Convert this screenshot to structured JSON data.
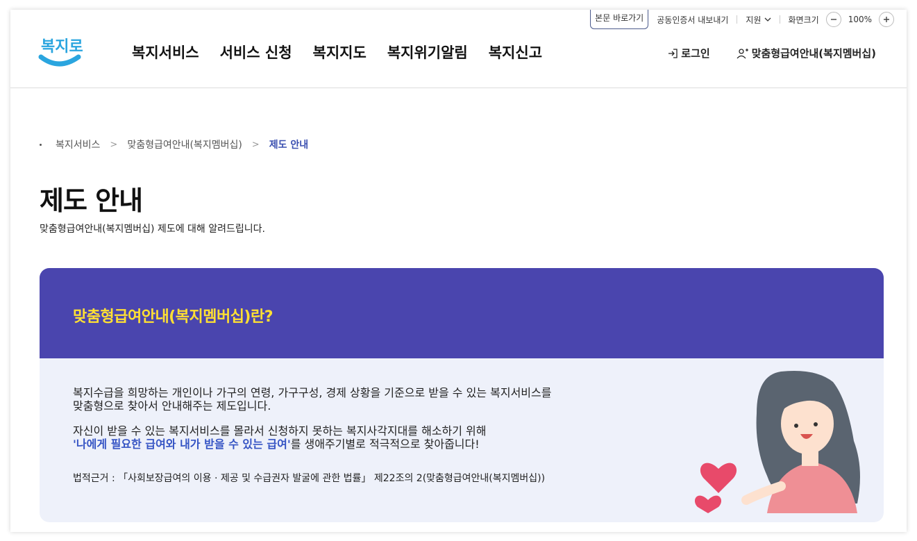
{
  "header": {
    "logo_text": "복지로",
    "skip_link": "본문 바로가기",
    "cert_export": "공동인증서 내보내기",
    "support": "지원",
    "screen_size": "화면크기",
    "zoom_level": "100%",
    "nav": [
      "복지서비스",
      "서비스 신청",
      "복지지도",
      "복지위기알림",
      "복지신고"
    ],
    "login": "로그인",
    "membership": "맞춤형급여안내(복지멤버십)"
  },
  "breadcrumb": [
    "복지서비스",
    "맞춤형급여안내(복지멤버십)",
    "제도 안내"
  ],
  "page": {
    "title": "제도 안내",
    "subtitle": "맞춤형급여안내(복지멤버십) 제도에 대해 알려드립니다."
  },
  "card": {
    "heading": "맞춤형급여안내(복지멤버십)란?",
    "para1_line1": "복지수급을 희망하는 개인이나 가구의 연령, 가구구성, 경제 상황을 기준으로 받을 수 있는 복지서비스를",
    "para1_line2": "맞춤형으로 찾아서 안내해주는 제도입니다.",
    "para2_line1": "자신이 받을 수 있는 복지서비스를 몰라서 신청하지 못하는 복지사각지대를 해소하기 위해",
    "para2_highlight": "'나에게 필요한 급여와 내가 받을 수 있는 급여'",
    "para2_rest": "를 생애주기별로 적극적으로 찾아줍니다!",
    "law": "법적근거 : 「사회보장급여의 이용 · 제공 및 수급권자 발굴에 관한 법률」 제22조의 2(맞춤형급여안내(복지멤버십))"
  },
  "colors": {
    "brand_blue": "#4a45ae",
    "heading_yellow": "#ffe033",
    "highlight_blue": "#3554c4",
    "card_bg": "#eef1fa",
    "logo_blue": "#2aa5df"
  }
}
